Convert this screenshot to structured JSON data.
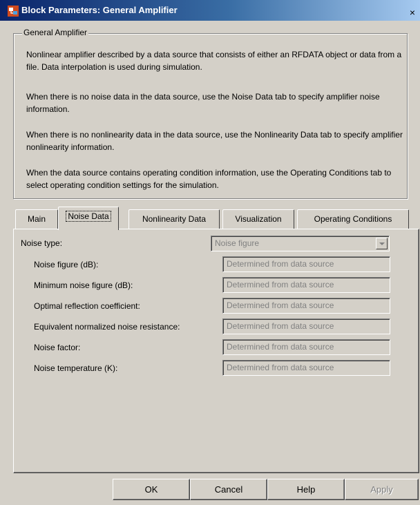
{
  "window": {
    "title": "Block Parameters: General Amplifier",
    "close_glyph": "×"
  },
  "group": {
    "legend": "General Amplifier",
    "paragraphs": [
      "Nonlinear amplifier described by a data source that consists of either an RFDATA object or data from a file. Data interpolation is used during simulation.",
      "When there is no noise data in the data source, use the Noise Data tab to specify amplifier noise information.",
      "When there is no nonlinearity data in the data source, use the Nonlinearity Data tab to specify amplifier nonlinearity information.",
      "When the data source contains operating condition information, use the Operating Conditions tab to select operating condition settings for the simulation."
    ]
  },
  "tabs": [
    {
      "label": "Main",
      "active": false
    },
    {
      "label": "Noise Data",
      "active": true
    },
    {
      "label": "Nonlinearity Data",
      "active": false
    },
    {
      "label": "Visualization",
      "active": false
    },
    {
      "label": "Operating Conditions",
      "active": false
    }
  ],
  "noise": {
    "type_label": "Noise type:",
    "type_value": "Noise figure",
    "fields": [
      {
        "label": "Noise figure (dB):",
        "value": "Determined from data source"
      },
      {
        "label": "Minimum noise figure (dB):",
        "value": "Determined from data source"
      },
      {
        "label": "Optimal reflection coefficient:",
        "value": "Determined from data source"
      },
      {
        "label": "Equivalent normalized noise resistance:",
        "value": "Determined from data source"
      },
      {
        "label": "Noise factor:",
        "value": "Determined from data source"
      },
      {
        "label": "Noise temperature (K):",
        "value": "Determined from data source"
      }
    ]
  },
  "buttons": {
    "ok": "OK",
    "cancel": "Cancel",
    "help": "Help",
    "apply": "Apply"
  },
  "icons": {
    "app": "simulink-block-icon",
    "close": "close-icon",
    "dropdown": "chevron-down-icon"
  }
}
